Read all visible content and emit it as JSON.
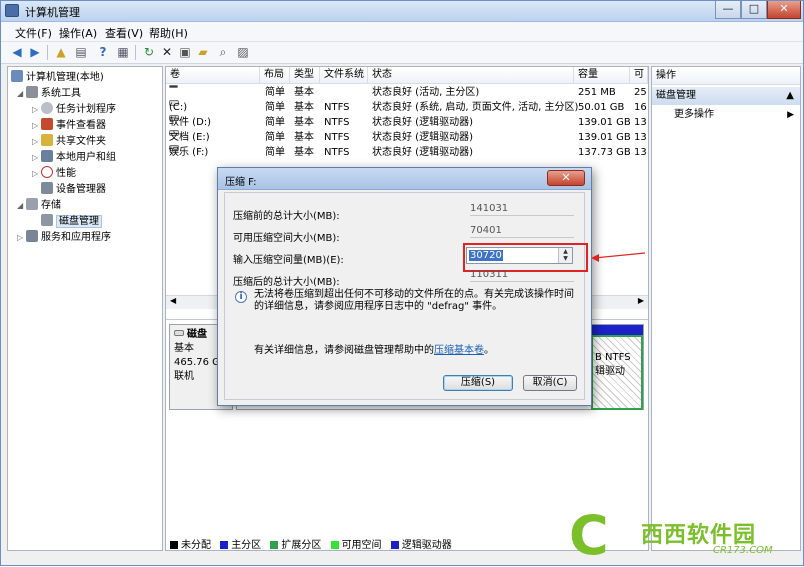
{
  "window": {
    "title": "计算机管理",
    "buttons": {
      "minimize": "—",
      "maximize": "□",
      "close": "✕"
    }
  },
  "menubar": [
    "文件(F)",
    "操作(A)",
    "查看(V)",
    "帮助(H)"
  ],
  "tree": {
    "root": "计算机管理(本地)",
    "system_tools": "系统工具",
    "task_scheduler": "任务计划程序",
    "event_viewer": "事件查看器",
    "shared_folders": "共享文件夹",
    "local_users": "本地用户和组",
    "performance": "性能",
    "device_manager": "设备管理器",
    "storage": "存储",
    "disk_management": "磁盘管理",
    "services_apps": "服务和应用程序"
  },
  "volume_table": {
    "headers": [
      "卷",
      "布局",
      "类型",
      "文件系统",
      "状态",
      "容量",
      "可"
    ],
    "rows": [
      {
        "vol": "",
        "layout": "简单",
        "type": "基本",
        "fs": "",
        "status": "状态良好 (活动, 主分区)",
        "cap": "251 MB",
        "free": "25"
      },
      {
        "vol": "(C:)",
        "layout": "简单",
        "type": "基本",
        "fs": "NTFS",
        "status": "状态良好 (系统, 启动, 页面文件, 活动, 主分区)",
        "cap": "50.01 GB",
        "free": "16"
      },
      {
        "vol": "软件 (D:)",
        "layout": "简单",
        "type": "基本",
        "fs": "NTFS",
        "status": "状态良好 (逻辑驱动器)",
        "cap": "139.01 GB",
        "free": "13"
      },
      {
        "vol": "文档 (E:)",
        "layout": "简单",
        "type": "基本",
        "fs": "NTFS",
        "status": "状态良好 (逻辑驱动器)",
        "cap": "139.01 GB",
        "free": "13"
      },
      {
        "vol": "娱乐 (F:)",
        "layout": "简单",
        "type": "基本",
        "fs": "NTFS",
        "status": "状态良好 (逻辑驱动器)",
        "cap": "137.73 GB",
        "free": "13"
      }
    ]
  },
  "disk": {
    "name": "磁盘",
    "type": "基本",
    "size": "465.76 GE",
    "status": "联机",
    "part_fs": "B NTFS",
    "part_status": "辑驱动"
  },
  "legend": [
    {
      "label": "未分配",
      "color": "#000000"
    },
    {
      "label": "主分区",
      "color": "#1b22c8"
    },
    {
      "label": "扩展分区",
      "color": "#2fa24a"
    },
    {
      "label": "可用空间",
      "color": "#33e233"
    },
    {
      "label": "逻辑驱动器",
      "color": "#1b22c8"
    }
  ],
  "actions": {
    "header": "操作",
    "section": "磁盘管理",
    "more": "更多操作"
  },
  "dialog": {
    "title": "压缩 F:",
    "total_before_label": "压缩前的总计大小(MB):",
    "total_before_value": "141031",
    "available_label": "可用压缩空间大小(MB):",
    "available_value": "70401",
    "input_label": "输入压缩空间量(MB)(E):",
    "input_value": "30720",
    "total_after_label": "压缩后的总计大小(MB):",
    "total_after_value": "110311",
    "info_text": "无法将卷压缩到超出任何不可移动的文件所在的点。有关完成该操作时间的详细信息，请参阅应用程序日志中的 \"defrag\" 事件。",
    "more_info_prefix": "有关详细信息，请参阅磁盘管理帮助中的",
    "more_info_link": "压缩基本卷",
    "more_info_suffix": "。",
    "ok_button": "压缩(S)",
    "cancel_button": "取消(C)"
  },
  "watermark": {
    "brand": "西西软件园",
    "site": "CR173.COM"
  },
  "colors": {
    "accent": "#3e73c6",
    "highlight_box": "#e02424",
    "watermark": "#7bbf2a"
  }
}
